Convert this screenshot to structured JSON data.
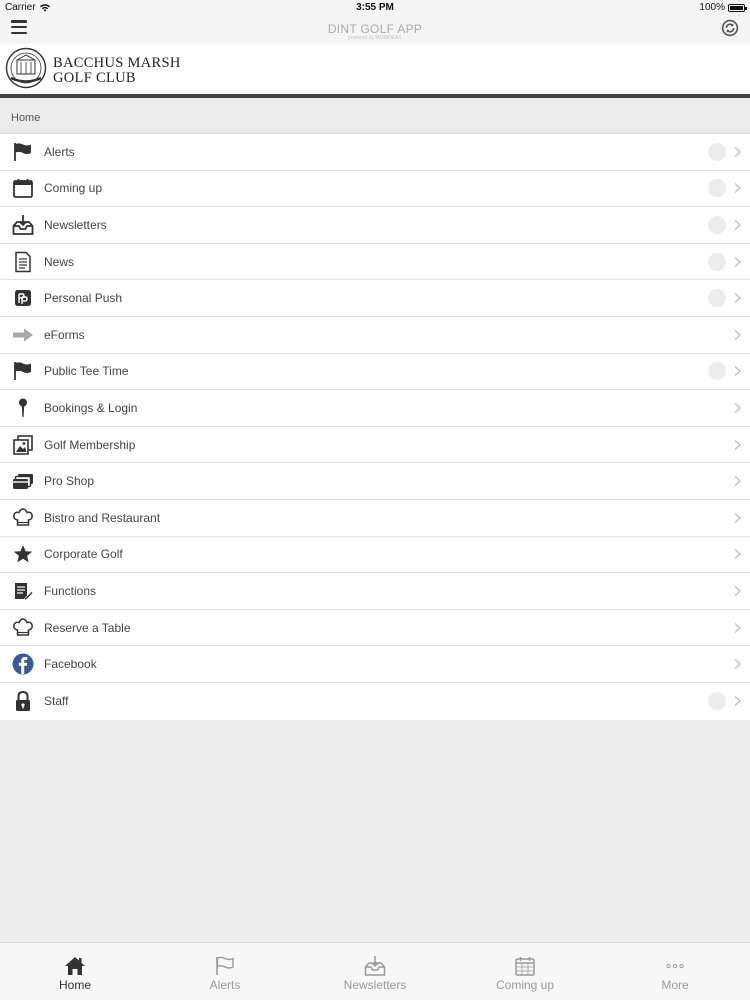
{
  "status_bar": {
    "carrier": "Carrier",
    "time": "3:55 PM",
    "battery": "100%"
  },
  "app_bar": {
    "title": "DINT GOLF APP",
    "subtitle": "powered by MOBIDEAS"
  },
  "club": {
    "name_line1": "BACCHUS MARSH",
    "name_line2": "GOLF CLUB"
  },
  "breadcrumb": "Home",
  "menu": [
    {
      "label": "Alerts",
      "icon": "flag-icon",
      "badge": true
    },
    {
      "label": "Coming up",
      "icon": "calendar-icon",
      "badge": true
    },
    {
      "label": "Newsletters",
      "icon": "inbox-download-icon",
      "badge": true
    },
    {
      "label": "News",
      "icon": "document-icon",
      "badge": true
    },
    {
      "label": "Personal Push",
      "icon": "personal-push-icon",
      "badge": true
    },
    {
      "label": "eForms",
      "icon": "arrow-right-icon",
      "badge": false
    },
    {
      "label": "Public Tee Time",
      "icon": "flag-icon",
      "badge": true
    },
    {
      "label": "Bookings & Login",
      "icon": "golf-tee-icon",
      "badge": false
    },
    {
      "label": "Golf Membership",
      "icon": "gallery-icon",
      "badge": false
    },
    {
      "label": "Pro Shop",
      "icon": "cards-icon",
      "badge": false
    },
    {
      "label": "Bistro and Restaurant",
      "icon": "chef-hat-icon",
      "badge": false
    },
    {
      "label": "Corporate Golf",
      "icon": "star-icon",
      "badge": false
    },
    {
      "label": "Functions",
      "icon": "notepad-icon",
      "badge": false
    },
    {
      "label": "Reserve a Table",
      "icon": "chef-hat-icon",
      "badge": false
    },
    {
      "label": "Facebook",
      "icon": "facebook-icon",
      "badge": false
    },
    {
      "label": "Staff",
      "icon": "lock-icon",
      "badge": true
    }
  ],
  "tabs": [
    {
      "label": "Home",
      "icon": "home-icon",
      "active": true
    },
    {
      "label": "Alerts",
      "icon": "flag-icon",
      "active": false
    },
    {
      "label": "Newsletters",
      "icon": "inbox-download-icon",
      "active": false
    },
    {
      "label": "Coming up",
      "icon": "calendar-icon",
      "active": false
    },
    {
      "label": "More",
      "icon": "more-dots-icon",
      "active": false
    }
  ],
  "colors": {
    "accent_dark": "#333333",
    "facebook": "#3b5998",
    "inactive_tab": "#999999",
    "header_rule": "#444444"
  }
}
